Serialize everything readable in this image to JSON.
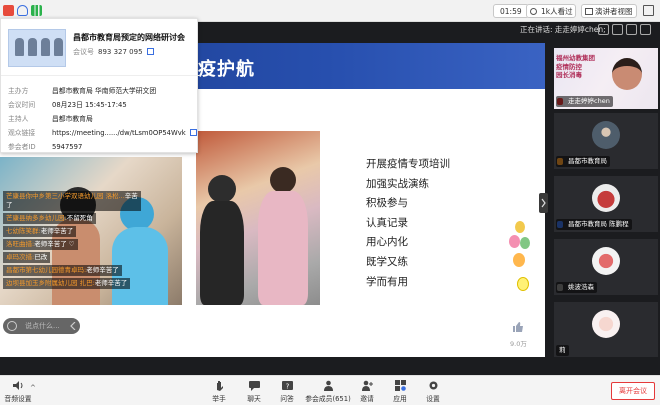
{
  "topbar": {
    "time": "01:59",
    "viewers": "1k人看过",
    "view_mode": "演讲者视图"
  },
  "speaking": "正在讲话: 走走婷婷chen;",
  "popup": {
    "title": "昌都市教育局预定的网络研讨会",
    "meeting_id_label": "会议号",
    "meeting_id": "893 327 095",
    "rows": [
      {
        "k": "主办方",
        "v": "昌都市教育局 华南师范大学研文团"
      },
      {
        "k": "会议时间",
        "v": "08月23日 15:45-17:45"
      },
      {
        "k": "主持人",
        "v": "昌都市教育局"
      },
      {
        "k": "观众链接",
        "v": "https://meeting....../dw/tLsm0OP54Wvk"
      },
      {
        "k": "参会者ID",
        "v": "5947597"
      }
    ]
  },
  "slide": {
    "title": "疫护航",
    "lines": [
      "开展疫情专项培训",
      "加强实战演练",
      "积极参与",
      "认真记录",
      "用心内化",
      "既学又练",
      "学而有用"
    ],
    "like_count": "9.0万"
  },
  "chat": {
    "messages": [
      {
        "name": "芒康县你中乡第三小学双语幼儿园 洛松...",
        "text": "辛苦了"
      },
      {
        "name": "芒康县纳多乡幼儿园:",
        "text": "不留死角"
      },
      {
        "name": "七幼陈笑群:",
        "text": "老师辛苦了"
      },
      {
        "name": "洛旺曲措:",
        "text": "老师辛苦了 ♡"
      },
      {
        "name": "卓玛次措:",
        "text": "已改"
      },
      {
        "name": "昌都市第七幼儿园德青卓玛:",
        "text": "老师辛苦了"
      },
      {
        "name": "边坝县加玉乡附属幼儿园 扎巴:",
        "text": "老师辛苦了"
      }
    ],
    "placeholder": "说点什么..."
  },
  "tiles": [
    {
      "label": "走走婷婷chen",
      "slide_lines": [
        "福州幼教集团",
        "疫情防控",
        "园长消毒"
      ]
    },
    {
      "label": "昌都市教育局"
    },
    {
      "label": "昌都市教育局 陈鹏程"
    },
    {
      "label": "姚波浩森"
    },
    {
      "label": "莉"
    }
  ],
  "toolbar": {
    "audio": "音频设置",
    "raise_hand": "举手",
    "chat": "聊天",
    "qa": "问答",
    "participants": "参会成员(651)",
    "invite": "邀请",
    "apps": "应用",
    "settings": "设置",
    "leave": "离开会议"
  },
  "colors": {
    "accent": "#3a6fe0",
    "danger": "#e5393a",
    "chat_name": "#f59a2b"
  }
}
